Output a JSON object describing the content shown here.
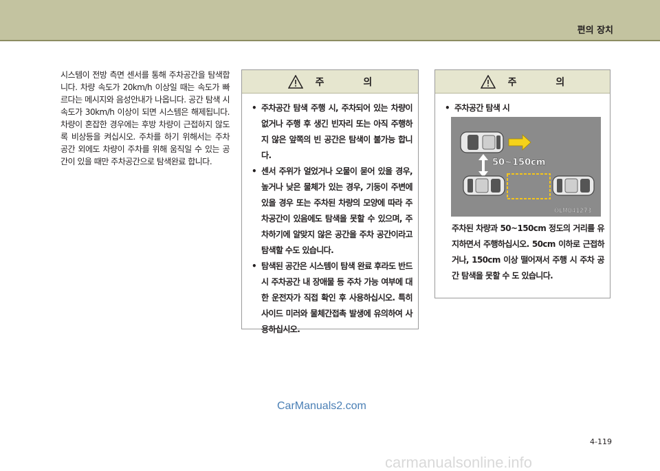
{
  "header": {
    "section_title": "편의 장치"
  },
  "intro": {
    "text": "시스템이 전방 측면 센서를 통해 주차공간을 탐색합니다. 차량 속도가 20km/h 이상일 때는 속도가 빠르다는 메시지와 음성안내가 나옵니다. 공간 탐색 시 속도가 30km/h 이상이 되면 시스템은 해제됩니다. 차량이 혼잡한 경우에는 후방 차량이 근접하지 않도록 비상등을 켜십시오. 주차를 하기 위해서는 주차 공간 외에도 차량이 주차를 위해 움직일 수 있는 공간이 있을 때만 주차공간으로 탐색완료 합니다."
  },
  "caution_left": {
    "title": "주 의",
    "items": [
      "주차공간 탐색 주행 시, 주차되어 있는 차량이 없거나 주행 후 생긴 빈자리 또는 아직 주행하지 않은 앞쪽의 빈 공간은 탐색이 불가능 합니다.",
      "센서 주위가 얼었거나 오물이 묻어 있을 경우, 높거나 낮은 물체가 있는 경우, 기둥이 주변에 있을 경우 또는 주차된 차량의 모양에 따라 주차공간이 있음에도 탐색을 못할 수 있으며, 주차하기에 알맞지 않은 공간을 주차 공간이라고 탐색할 수도 있습니다.",
      "탐색된 공간은 시스템이 탐색 완료 후라도 반드시 주차공간 내 장애물 등 주차 가능 여부에 대한 운전자가 직접 확인 후 사용하십시오. 특히 사이드 미러와 물체간접촉 발생에 유의하여 사용하십시오."
    ]
  },
  "caution_right": {
    "title": "주 의",
    "items": [
      "주차공간 탐색 시"
    ],
    "diagram": {
      "distance_label": "50~150cm",
      "figure_code": "OLM041273"
    },
    "after_text": "주차된 차량과 50~150cm 정도의 거리를 유지하면서 주행하십시오. 50cm 이하로 근접하거나, 150cm 이상 떨어져서 주행 시 주차 공간 탐색을 못할 수 도 있습니다."
  },
  "footer": {
    "watermark": "CarManuals2.com",
    "page_number": "4-119",
    "site_watermark": "carmanualsonline.info"
  },
  "icons": {
    "warning": "warning-triangle-icon"
  },
  "colors": {
    "header_band": "#c3c3a0",
    "caution_head": "#e6e6cf",
    "diagram_bg": "#8b8b8b",
    "arrow_yellow": "#f5d21a",
    "space_frame": "#f5c51a"
  }
}
